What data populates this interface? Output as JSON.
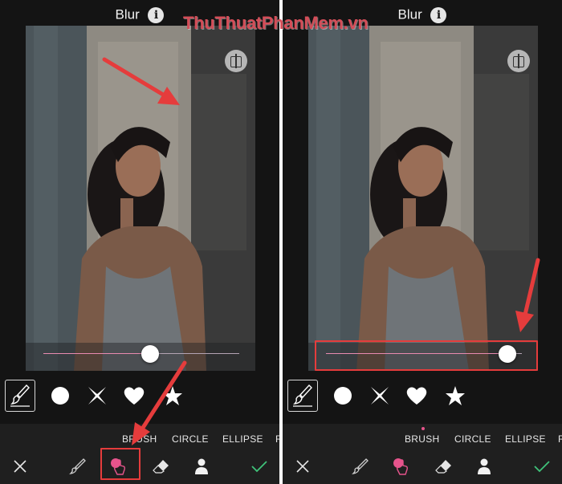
{
  "watermark": "ThuThuatPhanMem.vn",
  "accent_color": "#e6548c",
  "highlight_color": "#e53c3c",
  "left_panel": {
    "title": "Blur",
    "info_icon": "info-icon",
    "compare_icon": "split-compare-icon",
    "slider_value": 0.55,
    "shapes": [
      {
        "icon": "brush-icon",
        "selected": true
      },
      {
        "icon": "circle-icon",
        "selected": false
      },
      {
        "icon": "cross-icon",
        "selected": false
      },
      {
        "icon": "heart-icon",
        "selected": false
      },
      {
        "icon": "star-icon",
        "selected": false
      }
    ],
    "tabs": [
      "BRUSH",
      "CIRCLE",
      "ELLIPSE",
      "R"
    ],
    "tools": [
      "close-icon",
      "brush-tool-icon",
      "blur-touch-icon",
      "eraser-icon",
      "person-icon",
      "check-icon"
    ],
    "active_tool": "blur-touch-icon"
  },
  "right_panel": {
    "title": "Blur",
    "info_icon": "info-icon",
    "compare_icon": "split-compare-icon",
    "slider_value": 0.97,
    "shapes": [
      {
        "icon": "brush-icon",
        "selected": true
      },
      {
        "icon": "circle-icon",
        "selected": false
      },
      {
        "icon": "cross-icon",
        "selected": false
      },
      {
        "icon": "heart-icon",
        "selected": false
      },
      {
        "icon": "star-icon",
        "selected": false
      }
    ],
    "tabs": [
      "BRUSH",
      "CIRCLE",
      "ELLIPSE",
      "R"
    ],
    "active_tab": "BRUSH",
    "tools": [
      "close-icon",
      "brush-tool-icon",
      "blur-touch-icon",
      "eraser-icon",
      "person-icon",
      "check-icon"
    ],
    "active_tool": "blur-touch-icon"
  }
}
